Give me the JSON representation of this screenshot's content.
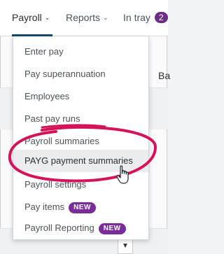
{
  "nav": {
    "payroll": "Payroll",
    "reports": "Reports",
    "in_tray": "In tray",
    "in_tray_count": "2"
  },
  "background": {
    "heading_fragment": "Ba"
  },
  "menu": {
    "items": [
      {
        "label": "Enter pay"
      },
      {
        "label": "Pay superannuation"
      },
      {
        "label": "Employees"
      },
      {
        "label": "Past pay runs"
      },
      {
        "label": "Payroll summaries"
      },
      {
        "label": "PAYG payment summaries"
      },
      {
        "label": "Payroll settings"
      },
      {
        "label": "Pay items",
        "badge": "NEW"
      },
      {
        "label": "Payroll Reporting",
        "badge": "NEW"
      }
    ]
  },
  "colors": {
    "accent_navy": "#0f4a6e",
    "badge_purple": "#7a2c9b",
    "highlight_magenta": "#d4145a"
  },
  "icons": {
    "chevron": "chevron-down-icon",
    "cursor": "hand-pointer-icon"
  }
}
